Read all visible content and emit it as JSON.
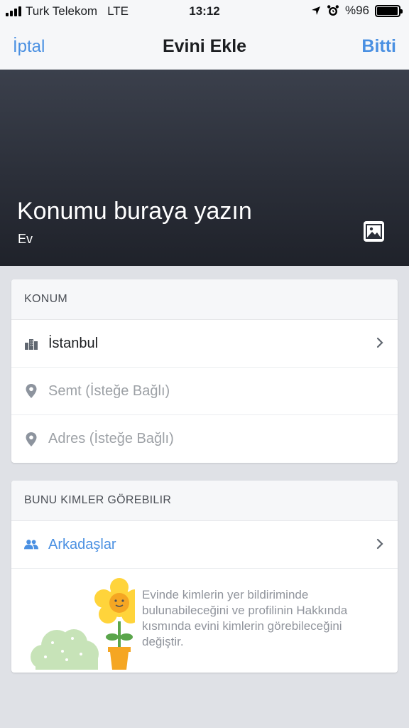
{
  "status_bar": {
    "carrier": "Turk Telekom",
    "network": "LTE",
    "time": "13:12",
    "battery": "%96",
    "battery_level": 0.96
  },
  "nav": {
    "cancel": "İptal",
    "title": "Evini Ekle",
    "done": "Bitti"
  },
  "hero": {
    "title": "Konumu buraya yazın",
    "subtitle": "Ev"
  },
  "location": {
    "header": "KONUM",
    "city": "İstanbul",
    "district_placeholder": "Semt (İsteğe Bağlı)",
    "address_placeholder": "Adres (İsteğe Bağlı)"
  },
  "privacy": {
    "header": "BUNU KIMLER GÖREBILIR",
    "audience": "Arkadaşlar",
    "info": "Evinde kimlerin yer bildiriminde bulunabileceğini ve profilinin Hakkında kısmında evini kimlerin görebileceğini değiştir."
  },
  "colors": {
    "accent": "#4a90e2",
    "hero_bg": "#2b2f39"
  },
  "icons": [
    "signal-icon",
    "location-arrow-icon",
    "alarm-icon",
    "battery-icon",
    "photo-icon",
    "city-icon",
    "map-pin-icon",
    "chevron-right-icon",
    "friends-icon",
    "flower-illustration"
  ]
}
